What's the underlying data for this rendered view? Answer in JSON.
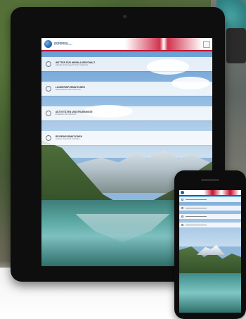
{
  "app": {
    "logo_title": "ÖSTERREICH",
    "logo_subtitle": "Wetter für Ihr Reiseziel"
  },
  "menu": {
    "items": [
      {
        "label": "WETTER FÜR IHREN AUFENTHALT",
        "desc": "Aktuelle Vorhersage für Ihren Urlaubsort",
        "icon": "sun-icon"
      },
      {
        "label": "LÄNDERINFORMATIONEN",
        "desc": "Wissenswertes über Österreich",
        "icon": "globe-icon"
      },
      {
        "label": "AKTIVITÄTEN UND ERLEBNISSE",
        "desc": "Entdecken Sie Österreich",
        "icon": "mountain-icon"
      },
      {
        "label": "REISEINFORMATIONEN",
        "desc": "Anreise, Unterkunft und Tipps",
        "icon": "info-icon"
      }
    ]
  },
  "colors": {
    "accent_red": "#c8102e",
    "brand_blue": "#1f5ea8"
  }
}
